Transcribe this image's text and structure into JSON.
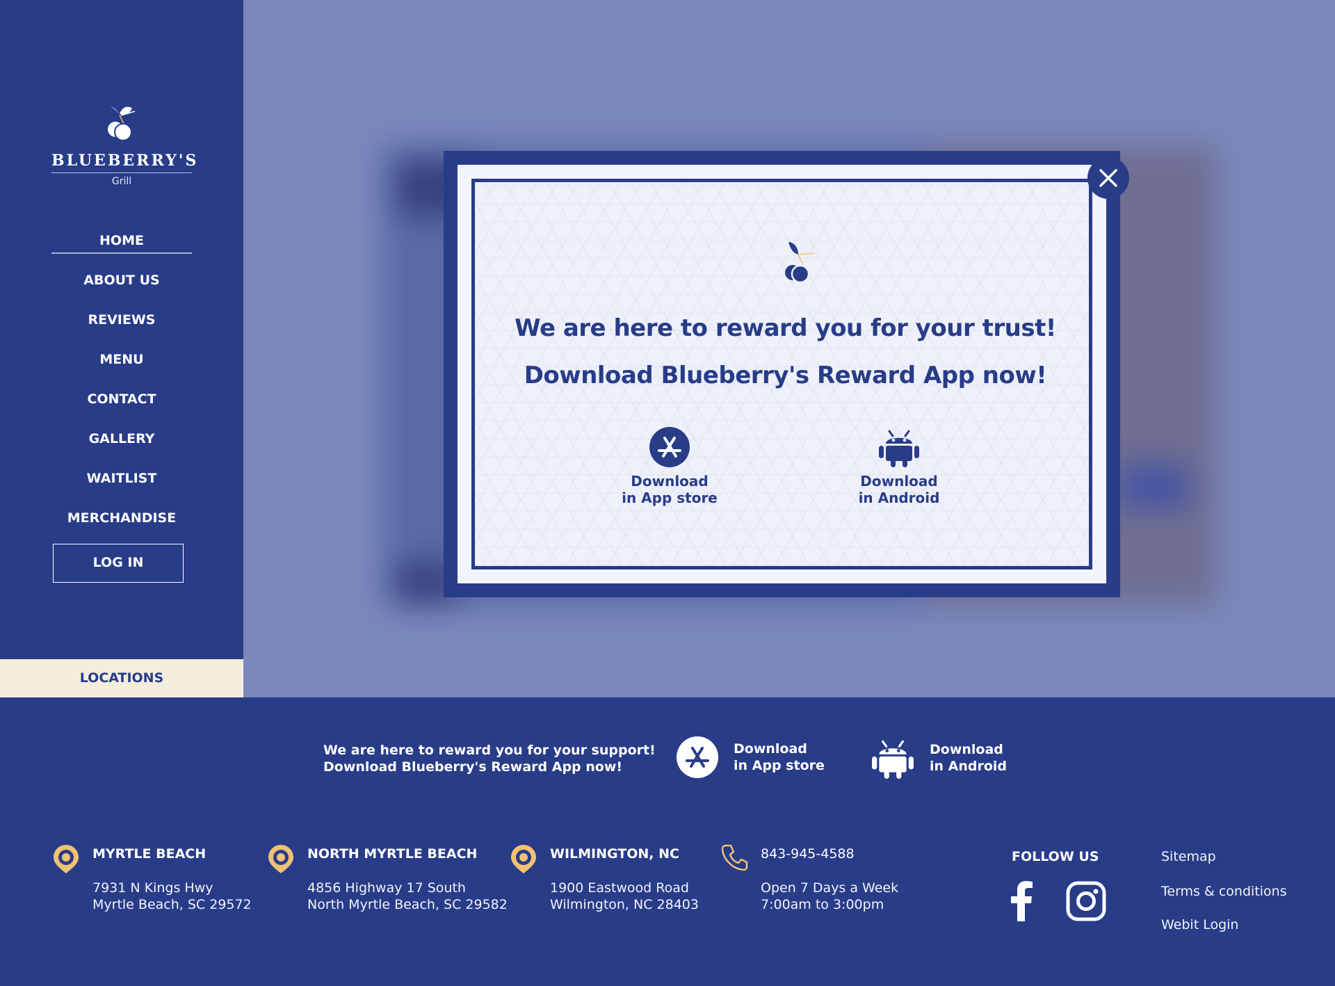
{
  "brand": {
    "name": "BLUEBERRY'S",
    "subtitle": "Grill"
  },
  "nav": {
    "items": [
      "HOME",
      "ABOUT US",
      "REVIEWS",
      "MENU",
      "CONTACT",
      "GALLERY",
      "WAITLIST",
      "MERCHANDISE"
    ],
    "active": "HOME",
    "login": "LOG IN",
    "locations": "LOCATIONS"
  },
  "modal": {
    "title_1": "We are here to reward you for your trust!",
    "title_2": "Download Blueberry's Reward App now!",
    "appstore_line1": "Download",
    "appstore_line2": "in App store",
    "android_line1": "Download",
    "android_line2": "in Android"
  },
  "footer": {
    "promo_line1": "We are here to reward you for your support!",
    "promo_line2": "Download Blueberry's Reward App now!",
    "appstore_line1": "Download",
    "appstore_line2": "in App store",
    "android_line1": "Download",
    "android_line2": "in Android",
    "locations": [
      {
        "name": "MYRTLE BEACH",
        "line1": "7931 N Kings Hwy",
        "line2": "Myrtle Beach, SC 29572"
      },
      {
        "name": "NORTH MYRTLE BEACH",
        "line1": "4856 Highway 17 South",
        "line2": "North Myrtle Beach, SC 29582"
      },
      {
        "name": "WILMINGTON, NC",
        "line1": "1900 Eastwood Road",
        "line2": "Wilmington, NC 28403"
      }
    ],
    "phone": "843-945-4588",
    "hours_line1": "Open 7 Days a Week",
    "hours_line2": "7:00am to 3:00pm",
    "follow_us": "FOLLOW US",
    "links": [
      "Sitemap",
      "Terms & conditions",
      "Webit Login"
    ]
  },
  "colors": {
    "primary": "#283c88",
    "overlay": "#7a88bc",
    "accent_gold": "#f0c274",
    "locations_bg": "#f5eede",
    "modal_bg": "#eef1fa"
  },
  "icons": {
    "logo": "blueberry-icon",
    "close": "close-icon",
    "appstore": "app-store-icon",
    "android": "android-icon",
    "pin": "map-pin-icon",
    "phone": "phone-icon",
    "facebook": "facebook-icon",
    "instagram": "instagram-icon"
  }
}
